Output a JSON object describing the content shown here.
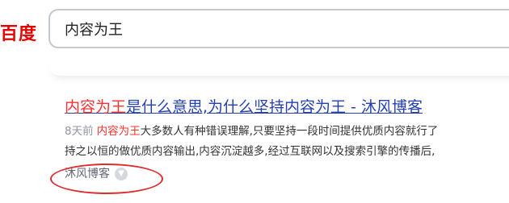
{
  "logo": {
    "text": "百度"
  },
  "search": {
    "value": "内容为王"
  },
  "result": {
    "title_highlight": "内容为王",
    "title_rest": "是什么意思,为什么坚持内容为王 - 沐风博客",
    "time": "8天前",
    "abstract_highlight": "内容为王",
    "abstract_line1_rest": "大多数人有种错误理解,只要坚持一段时间提供优质内容就行了",
    "abstract_line2": "持之以恒的做优质内容输出,内容沉淀越多,经过互联网以及搜索引擎的传播后,",
    "source": "沐风博客"
  },
  "colors": {
    "brand_red": "#e10602",
    "link_blue": "#2440b3",
    "highlight_red": "#f73131",
    "annotation_red": "#e02b2b"
  }
}
